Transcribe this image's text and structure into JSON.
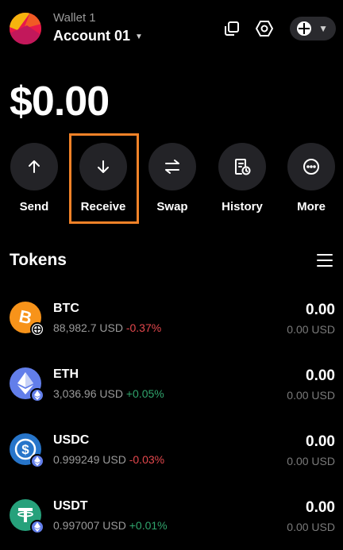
{
  "header": {
    "wallet_label": "Wallet 1",
    "account_name": "Account 01",
    "icons": [
      "copy-icon",
      "settings-icon",
      "network-icon"
    ]
  },
  "balance": "$0.00",
  "actions": [
    {
      "label": "Send",
      "icon": "arrow-up-icon"
    },
    {
      "label": "Receive",
      "icon": "arrow-down-icon",
      "highlighted": true
    },
    {
      "label": "Swap",
      "icon": "swap-icon"
    },
    {
      "label": "History",
      "icon": "history-icon"
    },
    {
      "label": "More",
      "icon": "more-icon"
    }
  ],
  "tokens": {
    "title": "Tokens",
    "items": [
      {
        "symbol": "BTC",
        "price": "88,982.7 USD",
        "change": "-0.37%",
        "amount": "0.00",
        "value": "0.00 USD",
        "color": "#f7931a"
      },
      {
        "symbol": "ETH",
        "price": "3,036.96 USD",
        "change": "+0.05%",
        "amount": "0.00",
        "value": "0.00 USD",
        "color": "#627eea"
      },
      {
        "symbol": "USDC",
        "price": "0.999249 USD",
        "change": "-0.03%",
        "amount": "0.00",
        "value": "0.00 USD",
        "color": "#2775ca"
      },
      {
        "symbol": "USDT",
        "price": "0.997007 USD",
        "change": "+0.01%",
        "amount": "0.00",
        "value": "0.00 USD",
        "color": "#26a17b"
      }
    ]
  },
  "colors": {
    "background": "#000000",
    "button": "#232327",
    "highlight": "#f28228",
    "negative": "#e5484d",
    "positive": "#30a46c"
  }
}
